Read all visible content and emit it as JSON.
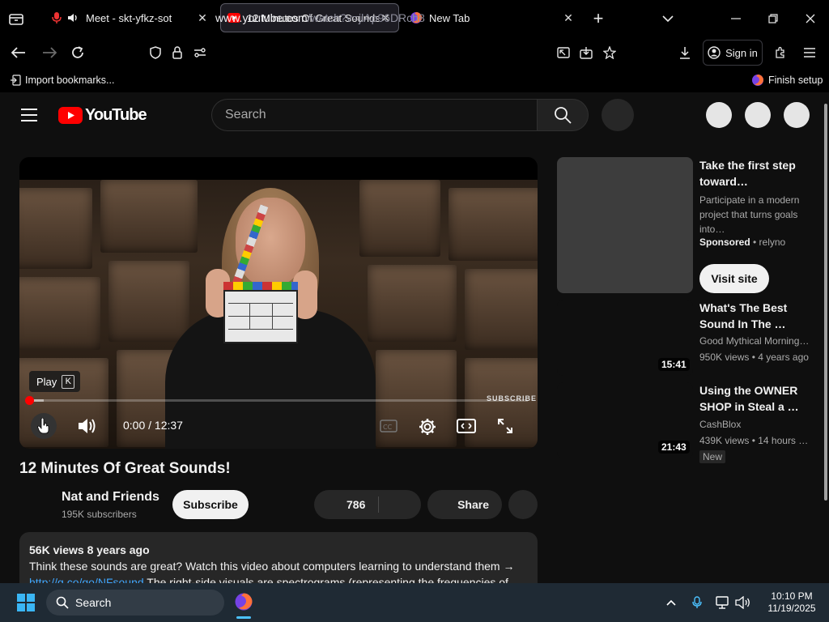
{
  "browser": {
    "tabs": [
      {
        "label": "Meet - skt-yfkz-sot",
        "active": false
      },
      {
        "label": "12 Minutes Of Great Sounds! - Y",
        "active": true
      },
      {
        "label": "New Tab",
        "active": false
      }
    ],
    "url": {
      "host": "www.youtube.com",
      "path": "/watch?v=jlAp96DRch8"
    },
    "sign_in": "Sign in",
    "bookmarks": {
      "import": "Import bookmarks...",
      "finish_setup": "Finish setup"
    }
  },
  "youtube": {
    "logo_text": "YouTube",
    "search_placeholder": "Search",
    "accent": "#ff0000",
    "player": {
      "tooltip": "Play",
      "tooltip_key": "K",
      "overlay_text": "SUBSCRIBE",
      "time": "0:00 / 12:37",
      "progress": 0.0,
      "loaded": 0.03
    },
    "video": {
      "title": "12 Minutes Of Great Sounds!",
      "channel": "Nat and Friends",
      "subscribers": "195K subscribers",
      "subscribe_label": "Subscribe",
      "likes": "786",
      "share_label": "Share"
    },
    "description": {
      "meta": "56K views  8 years ago",
      "line1": "Think these sounds are great? Watch this video about computers learning to understand them →",
      "link": "http://g.co/go/NFsound",
      "line2_rest": " The right-side visuals are spectrograms (representing the frequencies of"
    },
    "sidebar": {
      "ad": {
        "title": "Take the first step toward…",
        "desc": "Participate in a modern project that turns goals into…",
        "sponsored": "Sponsored",
        "advertiser": "relyno",
        "cta": "Visit site"
      },
      "items": [
        {
          "title": "What's The Best Sound In The …",
          "channel": "Good Mythical Morning…",
          "meta": "950K views • 4 years ago",
          "duration": "15:41"
        },
        {
          "title": "Using the OWNER SHOP in Steal a …",
          "channel": "CashBlox",
          "meta": "439K views • 14 hours …",
          "duration": "21:43",
          "badge": "New"
        }
      ]
    }
  },
  "taskbar": {
    "search_label": "Search",
    "time": "10:10 PM",
    "date": "11/19/2025"
  }
}
